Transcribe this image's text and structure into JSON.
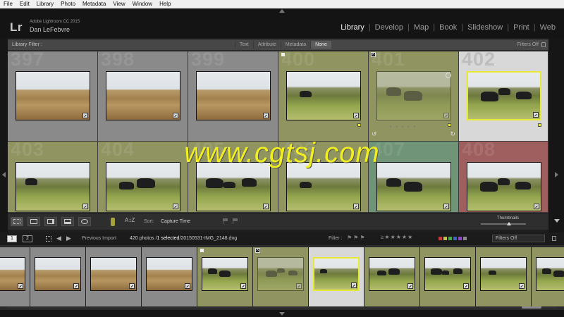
{
  "menu": [
    "File",
    "Edit",
    "Library",
    "Photo",
    "Metadata",
    "View",
    "Window",
    "Help"
  ],
  "identity": {
    "logo": "Lr",
    "product": "Adobe Lightroom CC 2015",
    "user": "Dan LeFebvre"
  },
  "modules": [
    "Library",
    "Develop",
    "Map",
    "Book",
    "Slideshow",
    "Print",
    "Web"
  ],
  "active_module": "Library",
  "library_filter": {
    "title": "Library Filter :",
    "tabs": [
      "Text",
      "Attribute",
      "Metadata",
      "None"
    ],
    "selected_tab": "None",
    "preset": "Filters Off"
  },
  "grid": {
    "rows": [
      [
        {
          "index": "397",
          "subject": "wheat",
          "bg": "#8a8a8a"
        },
        {
          "index": "398",
          "subject": "wheat",
          "bg": "#8a8a8a"
        },
        {
          "index": "399",
          "subject": "wheat",
          "bg": "#8a8a8a"
        },
        {
          "index": "400",
          "subject": "cows",
          "bg": "#8f9461",
          "flag": "pick"
        },
        {
          "index": "401",
          "subject": "cows",
          "bg": "#8f9461",
          "flag": "reject"
        },
        {
          "index": "402",
          "subject": "cows",
          "bg": "#d8d8d8",
          "selected": true
        }
      ],
      [
        {
          "index": "403",
          "subject": "cows",
          "bg": "#8f9461"
        },
        {
          "index": "404",
          "subject": "cows",
          "bg": "#8f9461"
        },
        {
          "index": "405",
          "subject": "cows",
          "bg": "#8f9461"
        },
        {
          "index": "406",
          "subject": "cows",
          "bg": "#8f9461"
        },
        {
          "index": "407",
          "subject": "cows",
          "bg": "#6f9478"
        },
        {
          "index": "408",
          "subject": "cows",
          "bg": "#a05f5f"
        }
      ]
    ]
  },
  "toolbar": {
    "sort_label": "Sort:",
    "sort_value": "Capture Time",
    "thumbnails_label": "Thumbnails"
  },
  "filmstrip_bar": {
    "screen1": "1",
    "screen2": "2",
    "source": "Previous Import",
    "count": "420 photos /",
    "selected": "1 selected",
    "path": "/20150531-IMG_2148.dng",
    "filter_label": "Filter :",
    "filters_off": "Filters Off",
    "swatch_colors": [
      "#c23a3a",
      "#c7c23a",
      "#4aa84a",
      "#3a62c2",
      "#8a4ac2",
      "#8a8a8a"
    ]
  },
  "filmstrip": [
    {
      "subject": "wheat",
      "bg": "#8a8a8a"
    },
    {
      "subject": "wheat",
      "bg": "#8a8a8a"
    },
    {
      "subject": "wheat",
      "bg": "#8a8a8a"
    },
    {
      "subject": "wheat",
      "bg": "#8a8a8a"
    },
    {
      "subject": "cows",
      "bg": "#8f9461",
      "flag": "pick"
    },
    {
      "subject": "cows",
      "bg": "#8f9461",
      "flag": "reject"
    },
    {
      "subject": "cows",
      "bg": "#d8d8d8",
      "selected": true
    },
    {
      "subject": "cows",
      "bg": "#8f9461"
    },
    {
      "subject": "cows",
      "bg": "#8f9461"
    },
    {
      "subject": "cows",
      "bg": "#8f9461"
    },
    {
      "subject": "cows",
      "bg": "#8f9461"
    }
  ],
  "watermark": "www.cgtsj.com"
}
